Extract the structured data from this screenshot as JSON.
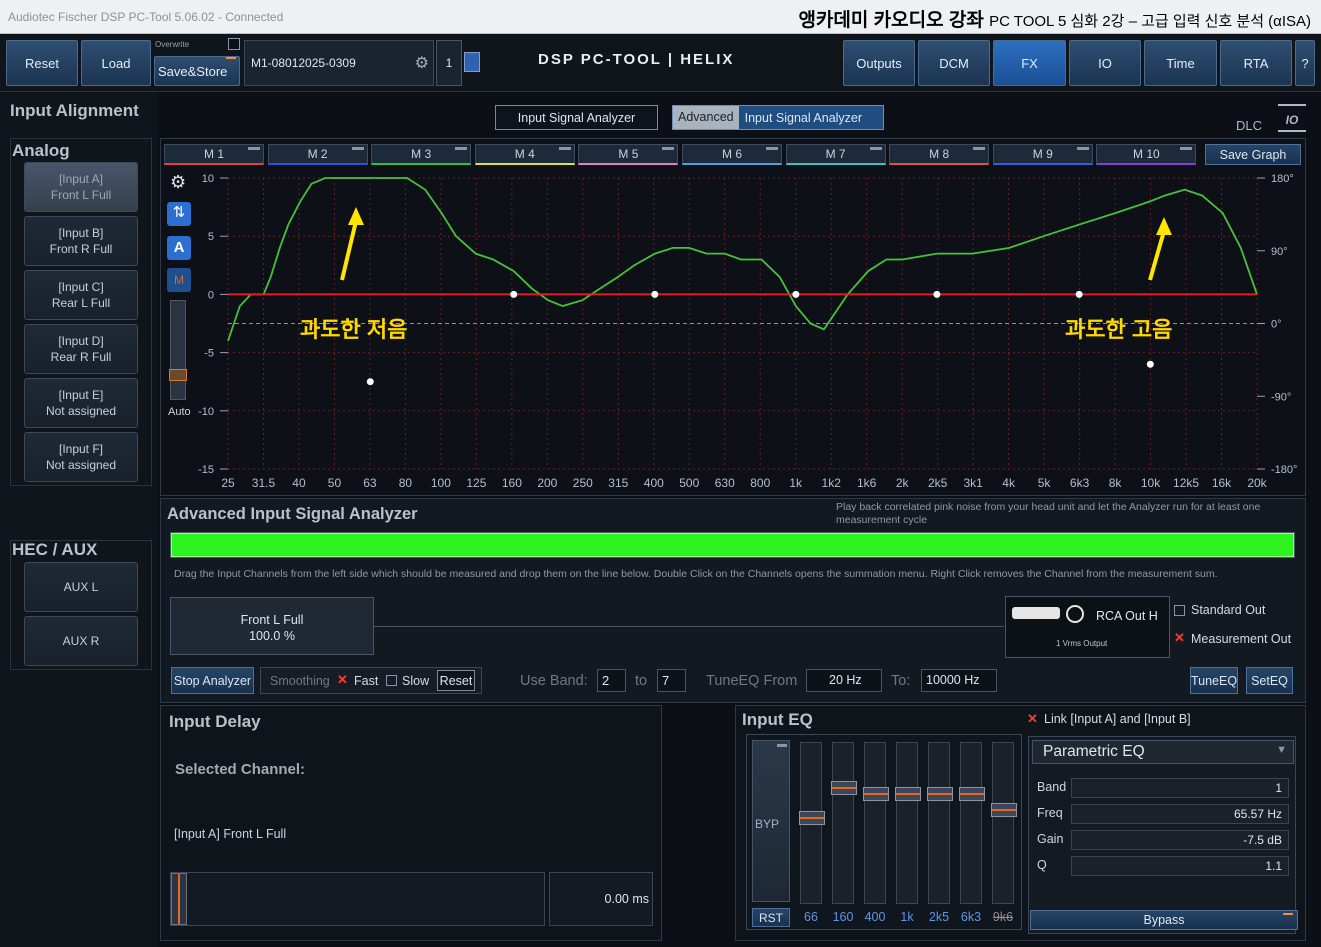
{
  "titlebar": {
    "app": "Audiotec Fischer DSP PC-Tool 5.06.02 - Connected",
    "course": "앵카데미 카오디오 강좌",
    "course_sub": "PC TOOL 5 심화 2강 – 고급 입력 신호 분석 (αISA)"
  },
  "toolbar": {
    "reset": "Reset",
    "load": "Load",
    "overwrite": "Overwrite",
    "save_store": "Save&Store",
    "preset": "M1-08012025-0309",
    "preset_no": "1",
    "logo": "DSP PC-TOOL | HELIX",
    "nav": [
      "Outputs",
      "DCM",
      "FX",
      "IO",
      "Time",
      "RTA",
      "?"
    ],
    "active": "FX"
  },
  "input_alignment": {
    "title": "Input Alignment",
    "analog": "Analog",
    "hec": "HEC / AUX",
    "channels": [
      {
        "l1": "[Input A]",
        "l2": "Front L Full"
      },
      {
        "l1": "[Input B]",
        "l2": "Front R Full"
      },
      {
        "l1": "[Input C]",
        "l2": "Rear L Full"
      },
      {
        "l1": "[Input D]",
        "l2": "Rear R Full"
      },
      {
        "l1": "[Input E]",
        "l2": "Not assigned"
      },
      {
        "l1": "[Input F]",
        "l2": "Not assigned"
      }
    ],
    "aux": [
      "AUX L",
      "AUX R"
    ]
  },
  "mode_tabs": {
    "isa": "Input Signal Analyzer",
    "adv_prefix": "Advanced",
    "adv": "Input Signal Analyzer"
  },
  "dlc": "DLC",
  "io_icon": "IO",
  "m_tabs": [
    "M 1",
    "M 2",
    "M 3",
    "M 4",
    "M 5",
    "M 6",
    "M 7",
    "M 8",
    "M 9",
    "M 10"
  ],
  "m_colors": [
    "#e04040",
    "#3050e0",
    "#30c040",
    "#e0e040",
    "#e080c0",
    "#50a0e0",
    "#40c0c0",
    "#e05050",
    "#3060e0",
    "#8040d0"
  ],
  "save_graph": "Save Graph",
  "side_tools": {
    "auto": "Auto",
    "a": "A",
    "m": "M"
  },
  "annotations": {
    "low": "과도한 저음",
    "high": "과도한 고음"
  },
  "chart_data": {
    "type": "line",
    "x_ticks": [
      "25",
      "31.5",
      "40",
      "50",
      "63",
      "80",
      "100",
      "125",
      "160",
      "200",
      "250",
      "315",
      "400",
      "500",
      "630",
      "800",
      "1k",
      "1k2",
      "1k6",
      "2k",
      "2k5",
      "3k1",
      "4k",
      "5k",
      "6k3",
      "8k",
      "10k",
      "12k5",
      "16k",
      "20k"
    ],
    "y_left_ticks": [
      "10",
      "5",
      "0",
      "-5",
      "-10",
      "-15"
    ],
    "y_right_ticks": [
      "180°",
      "90°",
      "0°",
      "-90°",
      "-180°"
    ],
    "ylim": [
      -15,
      10
    ],
    "grid": true,
    "series": [
      {
        "color": "#46c23a",
        "x": [
          25,
          27,
          29,
          31.5,
          33,
          35,
          37,
          40,
          43,
          47,
          50,
          53,
          56,
          60,
          63,
          70,
          75,
          80,
          90,
          100,
          110,
          125,
          140,
          160,
          180,
          200,
          220,
          250,
          280,
          315,
          350,
          400,
          450,
          500,
          560,
          630,
          700,
          800,
          900,
          1000,
          1100,
          1200,
          1400,
          1600,
          1800,
          2000,
          2500,
          3150,
          4000,
          5000,
          6300,
          8000,
          10000,
          11000,
          12500,
          14000,
          16000,
          18000,
          20000
        ],
        "y": [
          -4,
          -1,
          0,
          0,
          1.5,
          4,
          6,
          8,
          9.5,
          10,
          11,
          11,
          11,
          11,
          11,
          11,
          10.2,
          10,
          9,
          7,
          5,
          3.5,
          3,
          2,
          0.5,
          -0.5,
          -1,
          -0.5,
          0.5,
          1.5,
          2.5,
          3.5,
          4,
          4,
          3.5,
          3.5,
          3,
          3,
          1.5,
          -1,
          -2.5,
          -3,
          0,
          2,
          3,
          3,
          3.5,
          3.5,
          4,
          5,
          6,
          7,
          8,
          8.5,
          9,
          8.5,
          7,
          4,
          0
        ]
      },
      {
        "color": "#e02020",
        "x": [
          25,
          20000
        ],
        "y": [
          0,
          0
        ]
      }
    ],
    "points": [
      {
        "x": 63,
        "y": -7.5
      },
      {
        "x": 160,
        "y": 0
      },
      {
        "x": 400,
        "y": 0
      },
      {
        "x": 1000,
        "y": 0
      },
      {
        "x": 2500,
        "y": 0
      },
      {
        "x": 6300,
        "y": 0
      },
      {
        "x": 10000,
        "y": -6
      }
    ]
  },
  "asa": {
    "title": "Advanced Input Signal Analyzer",
    "hint": "Play back correlated pink noise from your head unit and let the Analyzer run for at least one measurement cycle",
    "progress": 1,
    "drag_hint": "Drag the Input Channels from the left side which should be measured and drop them on the line below. Double Click on the Channels opens the summation menu. Right Click removes the Channel from the measurement sum.",
    "channel": "Front L Full",
    "percent": "100.0 %",
    "source": "RCA Out H",
    "source_sub": "1 Vrms Output",
    "standard_out": "Standard Out",
    "measurement_out": "Measurement Out",
    "stop": "Stop Analyzer",
    "smoothing": "Smoothing",
    "fast": "Fast",
    "slow": "Slow",
    "reset": "Reset",
    "use_band": "Use Band:",
    "band_from": "2",
    "to": "to",
    "band_to": "7",
    "tune_from": "TuneEQ From",
    "tune_from_val": "20 Hz",
    "tune_to": "To:",
    "tune_to_val": "10000 Hz",
    "tuneeq": "TuneEQ",
    "seteq": "SetEQ"
  },
  "delay": {
    "title": "Input Delay",
    "selected": "Selected Channel:",
    "channel": "[Input A] Front L Full",
    "value": "0.00 ms"
  },
  "eq": {
    "title": "Input EQ",
    "link": "Link [Input A] and [Input B]",
    "byp": "BYP",
    "rst": "RST",
    "bands": [
      "66",
      "160",
      "400",
      "1k",
      "2k5",
      "6k3",
      "9k6"
    ],
    "type": "Parametric EQ",
    "band_label": "Band",
    "band": "1",
    "freq_label": "Freq",
    "freq": "65.57 Hz",
    "gain_label": "Gain",
    "gain": "-7.5 dB",
    "q_label": "Q",
    "q": "1.1",
    "bypass": "Bypass"
  }
}
